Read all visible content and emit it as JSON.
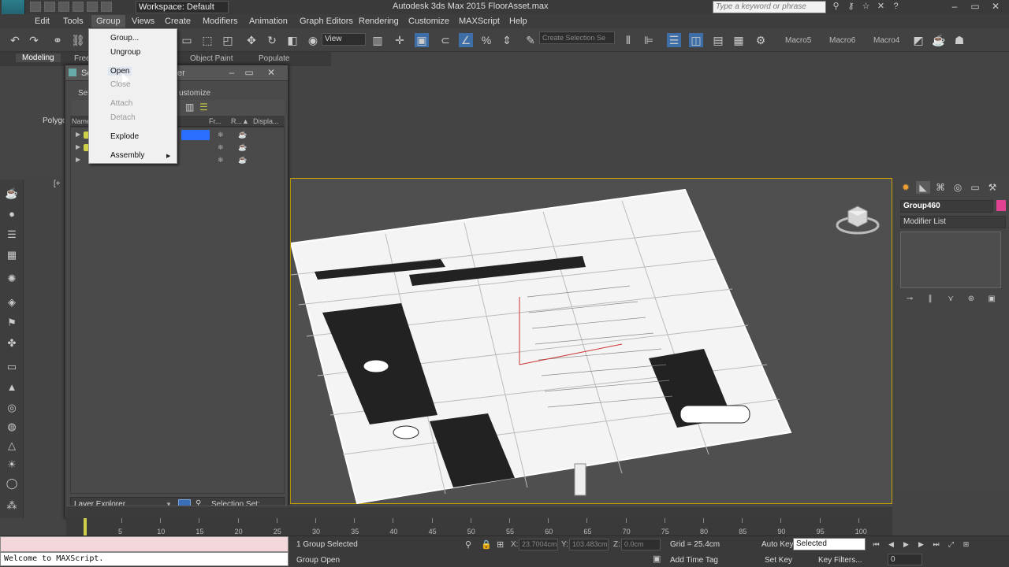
{
  "titlebar": {
    "workspace": "Workspace: Default",
    "app_title": "Autodesk 3ds Max 2015    FloorAsset.max",
    "search_placeholder": "Type a keyword or phrase"
  },
  "menubar": {
    "items": [
      "Edit",
      "Tools",
      "Group",
      "Views",
      "Create",
      "Modifiers",
      "Animation",
      "Graph Editors",
      "Rendering",
      "Customize",
      "MAXScript",
      "Help"
    ]
  },
  "toolbar": {
    "view_dropdown": "View",
    "selection_set_placeholder": "Create Selection Se",
    "macros": [
      "Macro5",
      "Macro6",
      "Macro4"
    ]
  },
  "ribbon": {
    "tabs": [
      "Modeling",
      "Freeform",
      "Object Paint",
      "Populate"
    ],
    "panel_label": "Polygon"
  },
  "group_menu": {
    "items": [
      {
        "label": "Group...",
        "enabled": true
      },
      {
        "label": "Ungroup",
        "enabled": true
      },
      {
        "label": "Open",
        "enabled": true
      },
      {
        "label": "Close",
        "enabled": false
      },
      {
        "label": "Attach",
        "enabled": false
      },
      {
        "label": "Detach",
        "enabled": false
      },
      {
        "label": "Explode",
        "enabled": true
      },
      {
        "label": "Assembly",
        "enabled": true
      }
    ]
  },
  "scene_explorer": {
    "title_partial": "Sc",
    "title_suffix": "er",
    "menu_select_partial": "Sel",
    "menu_customize_partial": "ustomize",
    "columns": [
      "Name",
      "Fr...",
      "R...▲",
      "Displa..."
    ],
    "footer_layer": "Layer Explorer",
    "footer_selection_set": "Selection Set:"
  },
  "viewport": {
    "label": "[+"
  },
  "command_panel": {
    "object_name": "Group460",
    "object_color": "#e14393",
    "modifier_list": "Modifier List"
  },
  "timeline": {
    "ticks": [
      "5",
      "10",
      "15",
      "20",
      "25",
      "30",
      "35",
      "40",
      "45",
      "50",
      "55",
      "60",
      "65",
      "70",
      "75",
      "80",
      "85",
      "90",
      "95",
      "100"
    ]
  },
  "status": {
    "listener": "Welcome to MAXScript.",
    "selected": "1 Group Selected",
    "prompt": "Group Open",
    "x_label": "X:",
    "x_value": "23.7004cm",
    "y_label": "Y:",
    "y_value": "103.483cm",
    "z_label": "Z:",
    "z_value": "0.0cm",
    "grid": "Grid = 25.4cm",
    "add_time_tag": "Add Time Tag",
    "auto_key": "Auto Key",
    "set_key": "Set Key",
    "key_mode": "Selected",
    "key_filters": "Key Filters...",
    "frame": "0"
  }
}
